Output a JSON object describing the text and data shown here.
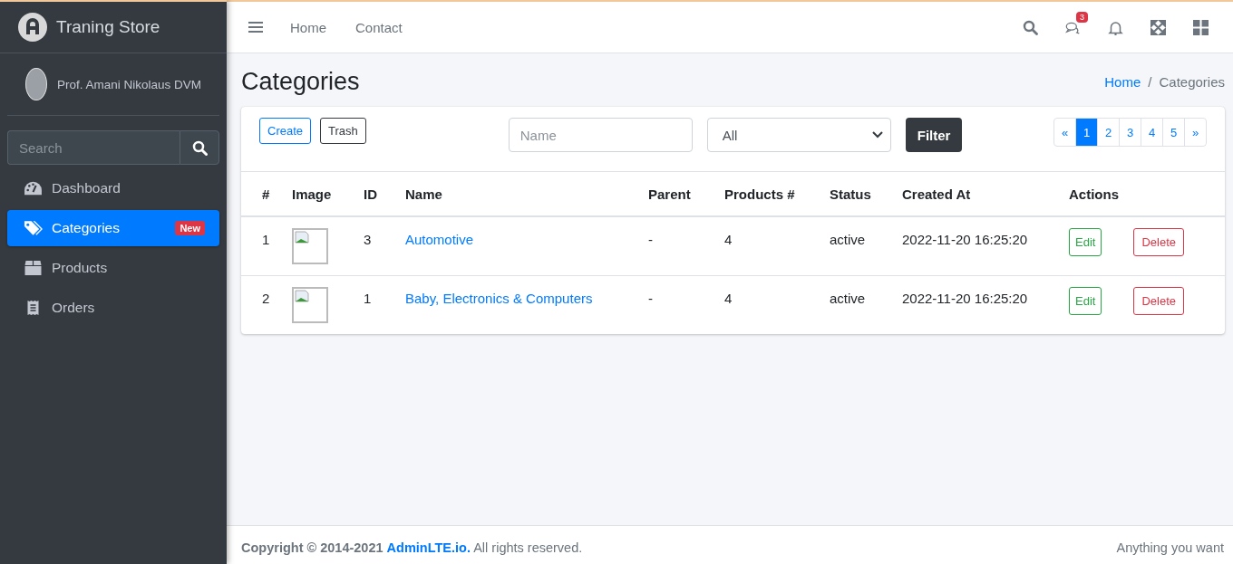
{
  "brand": {
    "name": "Traning Store"
  },
  "user": {
    "name": "Prof. Amani Nikolaus DVM"
  },
  "sidebar": {
    "search": {
      "placeholder": "Search"
    },
    "items": [
      {
        "label": "Dashboard",
        "kind": "dashboard",
        "selected": false
      },
      {
        "label": "Categories",
        "kind": "tags",
        "selected": true,
        "badge": "New"
      },
      {
        "label": "Products",
        "kind": "box",
        "selected": false
      },
      {
        "label": "Orders",
        "kind": "receipt",
        "selected": false
      }
    ]
  },
  "navbar": {
    "links": [
      "Home",
      "Contact"
    ],
    "messages_badge": "3"
  },
  "page": {
    "title": "Categories",
    "breadcrumb": [
      {
        "label": "Home",
        "link": true
      },
      {
        "label": "Categories",
        "link": false
      }
    ],
    "breadcrumb_separator": "/"
  },
  "toolbar": {
    "create": "Create",
    "trash": "Trash",
    "name_placeholder": "Name",
    "status_value": "All",
    "filter": "Filter"
  },
  "pagination": [
    {
      "label": "«",
      "selected": false
    },
    {
      "label": "1",
      "selected": true
    },
    {
      "label": "2",
      "selected": false
    },
    {
      "label": "3",
      "selected": false
    },
    {
      "label": "4",
      "selected": false
    },
    {
      "label": "5",
      "selected": false
    },
    {
      "label": "»",
      "selected": false
    }
  ],
  "table": {
    "columns": [
      "#",
      "Image",
      "ID",
      "Name",
      "Parent",
      "Products #",
      "Status",
      "Created At",
      "Actions"
    ],
    "rows": [
      {
        "index": "1",
        "id": "3",
        "name": "Automotive",
        "parent": "-",
        "products": "4",
        "status": "active",
        "created_at": "2022-11-20 16:25:20",
        "edit": "Edit",
        "delete": "Delete"
      },
      {
        "index": "2",
        "id": "1",
        "name": "Baby, Electronics & Computers",
        "parent": "-",
        "products": "4",
        "status": "active",
        "created_at": "2022-11-20 16:25:20",
        "edit": "Edit",
        "delete": "Delete"
      }
    ]
  },
  "footer": {
    "copyright_prefix": "**Copyright © 2014-2021**",
    "copyright_link": "AdminLTE.io.",
    "copyright_suffix": "All rights reserved.",
    "right_text": "Anything you want"
  }
}
